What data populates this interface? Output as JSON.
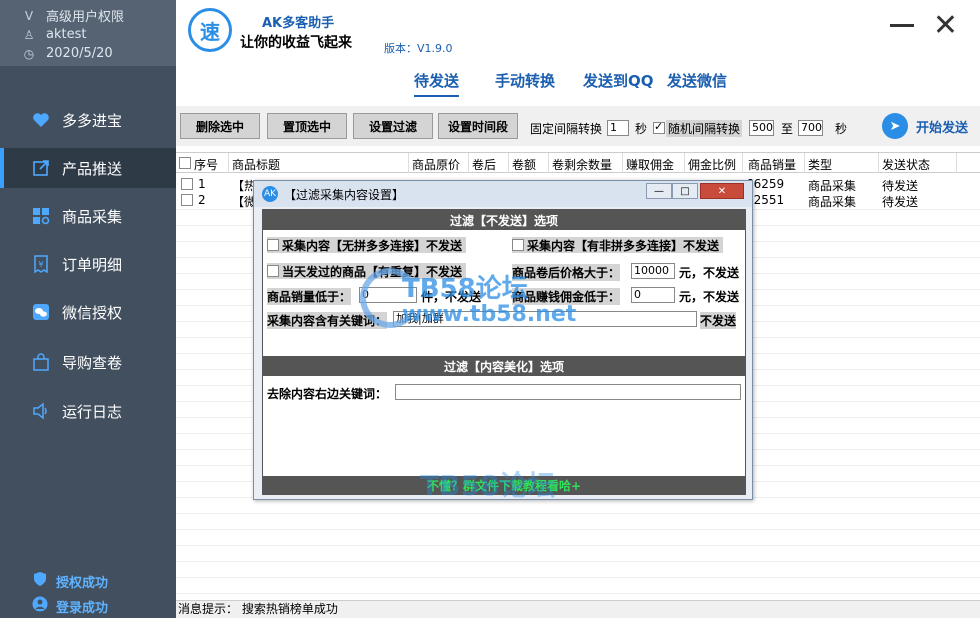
{
  "sidebar": {
    "user_level": "高级用户权限",
    "username": "aktest",
    "date": "2020/5/20",
    "items": [
      {
        "label": "多多进宝",
        "icon": "heart-icon"
      },
      {
        "label": "产品推送",
        "icon": "share-icon"
      },
      {
        "label": "商品采集",
        "icon": "grid-icon"
      },
      {
        "label": "订单明细",
        "icon": "receipt-icon"
      },
      {
        "label": "微信授权",
        "icon": "wechat-icon"
      },
      {
        "label": "导购查卷",
        "icon": "bag-icon"
      },
      {
        "label": "运行日志",
        "icon": "speaker-icon"
      }
    ],
    "auth_status": "授权成功",
    "login_status": "登录成功"
  },
  "header": {
    "logo_char": "速",
    "app_name": "AK多客助手",
    "slogan": "让你的收益飞起来",
    "version": "版本：V1.9.0"
  },
  "tabs": [
    "待发送",
    "手动转换",
    "发送到QQ",
    "发送微信"
  ],
  "toolbar": {
    "delete_selected": "删除选中",
    "pin_selected": "置顶选中",
    "set_filter": "设置过滤",
    "set_time": "设置时间段",
    "fixed_interval_label": "固定间隔转换",
    "fixed_interval_value": "1",
    "sec1": "秒",
    "random_interval_label": "随机间隔转换",
    "random_min": "500",
    "to": "至",
    "random_max": "700",
    "sec2": "秒",
    "start": "开始发送"
  },
  "table": {
    "columns": [
      "序号",
      "商品标题",
      "商品原价",
      "卷后",
      "卷额",
      "卷剩余数量",
      "赚取佣金",
      "佣金比例",
      "商品销量",
      "类型",
      "发送状态"
    ],
    "rows": [
      {
        "no": "1",
        "title": "【热",
        "sales": "66259",
        "type": "商品采集",
        "status": "待发送"
      },
      {
        "no": "2",
        "title": "【微",
        "sales": "12551",
        "type": "商品采集",
        "status": "待发送"
      }
    ]
  },
  "status": {
    "message": "消息提示：  搜索热销榜单成功"
  },
  "dialog": {
    "title": "【过滤采集内容设置】",
    "section1": "过滤【不发送】选项",
    "opt_no_link": "采集内容【无拼多多连接】不发送",
    "opt_non_pdd": "采集内容【有非拼多多连接】不发送",
    "opt_dup": "当天发过的商品【有重复】不发送",
    "price_label": "商品卷后价格大于：",
    "price_value": "10000",
    "price_unit": "元，不发送",
    "sales_label": "商品销量低于：",
    "sales_value": "0",
    "sales_unit": "件，不发送",
    "commission_label": "商品赚钱佣金低于：",
    "commission_value": "0",
    "commission_unit": "元，不发送",
    "keyword_label": "采集内容含有关键词：",
    "keyword_value": "加我|加群",
    "keyword_unit": "不发送",
    "section2": "过滤【内容美化】选项",
    "strip_label": "去除内容右边关键词：",
    "strip_value": "",
    "footer": "不懂？群文件下载教程看哈+"
  },
  "watermark": {
    "a": "TB58论坛",
    "b": "www.tb58.net",
    "c": "TB58论坛"
  }
}
